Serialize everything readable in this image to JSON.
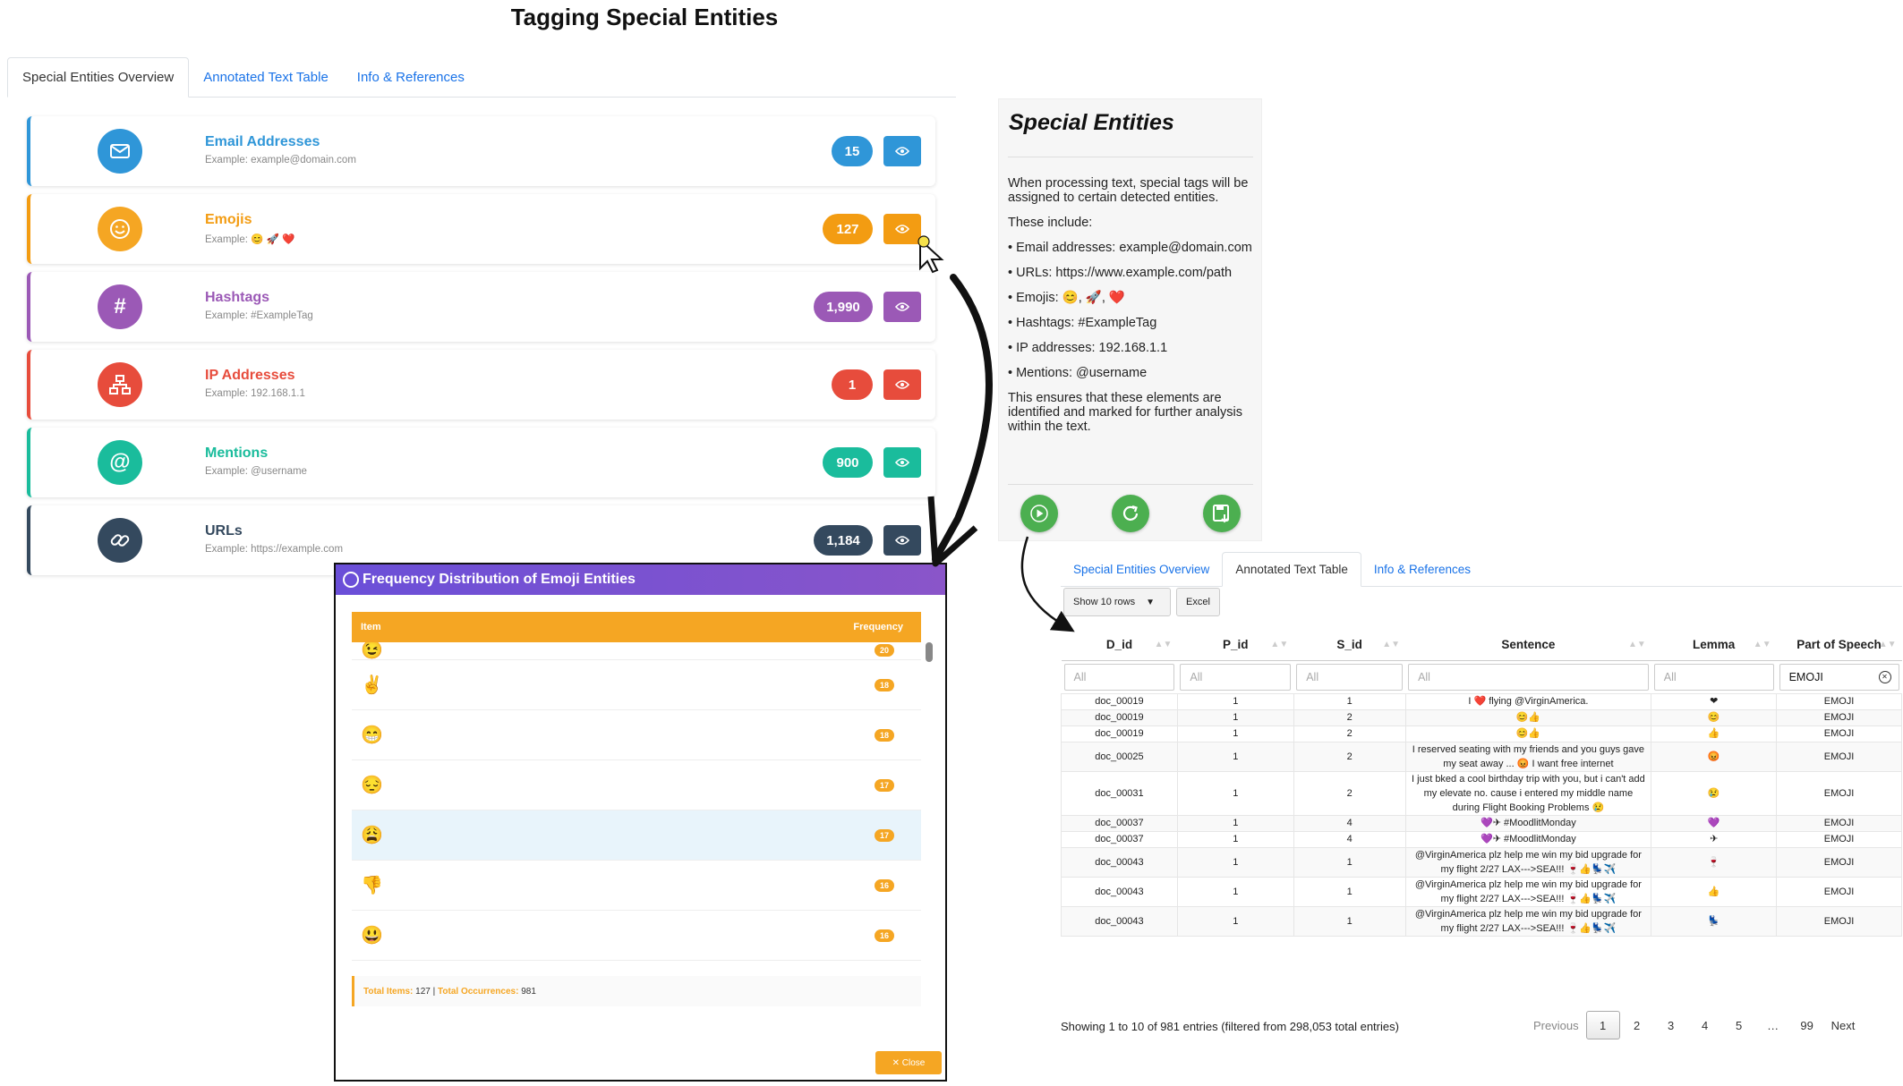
{
  "page_title": "Tagging Special Entities",
  "tabs_left": [
    "Special Entities Overview",
    "Annotated Text Table",
    "Info & References"
  ],
  "tabs_right": [
    "Special Entities Overview",
    "Annotated Text Table",
    "Info & References"
  ],
  "entities": [
    {
      "title": "Email Addresses",
      "example": "Example: example@domain.com",
      "count": "15",
      "color": "#2f96d8",
      "icon": "envelope-icon"
    },
    {
      "title": "Emojis",
      "example": "Example: 😊 🚀 ❤️",
      "count": "127",
      "color": "#f39c12",
      "icon": "smile-icon"
    },
    {
      "title": "Hashtags",
      "example": "Example: #ExampleTag",
      "count": "1,990",
      "color": "#9b59b6",
      "icon": "hashtag-icon"
    },
    {
      "title": "IP Addresses",
      "example": "Example: 192.168.1.1",
      "count": "1",
      "color": "#e74c3c",
      "icon": "network-icon"
    },
    {
      "title": "Mentions",
      "example": "Example: @username",
      "count": "900",
      "color": "#1abc9c",
      "icon": "at-icon"
    },
    {
      "title": "URLs",
      "example": "Example: https://example.com",
      "count": "1,184",
      "color": "#34495e",
      "icon": "link-icon"
    }
  ],
  "info": {
    "title": "Special Entities",
    "paragraphs": [
      "When processing text, special tags will be assigned to certain detected entities.",
      "These include:",
      "• Email addresses: example@domain.com",
      "• URLs: https://www.example.com/path",
      "• Emojis: 😊, 🚀, ❤️",
      "• Hashtags: #ExampleTag",
      "• IP addresses: 192.168.1.1",
      "• Mentions: @username",
      "This ensures that these elements are identified and marked for further analysis within the text."
    ]
  },
  "modal": {
    "title": "Frequency Distribution of Emoji Entities",
    "col_item": "Item",
    "col_freq": "Frequency",
    "rows": [
      {
        "item": "😉",
        "freq": "20"
      },
      {
        "item": "✌️",
        "freq": "18"
      },
      {
        "item": "😁",
        "freq": "18"
      },
      {
        "item": "😔",
        "freq": "17"
      },
      {
        "item": "😩",
        "freq": "17"
      },
      {
        "item": "👎",
        "freq": "16"
      },
      {
        "item": "😃",
        "freq": "16"
      }
    ],
    "total_items_label": "Total Items:",
    "total_items": "127",
    "separator": "|",
    "total_occ_label": "Total Occurrences:",
    "total_occ": "981",
    "close_label": "✕ Close"
  },
  "table": {
    "show_rows": "Show 10 rows",
    "excel": "Excel",
    "columns": [
      "D_id",
      "P_id",
      "S_id",
      "Sentence",
      "Lemma",
      "Part of Speech"
    ],
    "filters": [
      "All",
      "All",
      "All",
      "All",
      "All",
      "EMOJI"
    ],
    "rows": [
      {
        "d": "doc_00019",
        "p": "1",
        "s": "1",
        "sentence": "I ❤️ flying @VirginAmerica.",
        "lemma": "❤",
        "pos": "EMOJI"
      },
      {
        "d": "doc_00019",
        "p": "1",
        "s": "2",
        "sentence": "😊👍",
        "lemma": "😊",
        "pos": "EMOJI"
      },
      {
        "d": "doc_00019",
        "p": "1",
        "s": "2",
        "sentence": "😊👍",
        "lemma": "👍",
        "pos": "EMOJI"
      },
      {
        "d": "doc_00025",
        "p": "1",
        "s": "2",
        "sentence": "I reserved seating with my friends and you guys gave my seat away ... 😡 I want free internet",
        "lemma": "😡",
        "pos": "EMOJI"
      },
      {
        "d": "doc_00031",
        "p": "1",
        "s": "2",
        "sentence": "I just bked a cool birthday trip with you, but i can't add my elevate no. cause i entered my middle name during Flight Booking Problems 😢",
        "lemma": "😢",
        "pos": "EMOJI"
      },
      {
        "d": "doc_00037",
        "p": "1",
        "s": "4",
        "sentence": "💜✈ #MoodlitMonday",
        "lemma": "💜",
        "pos": "EMOJI"
      },
      {
        "d": "doc_00037",
        "p": "1",
        "s": "4",
        "sentence": "💜✈ #MoodlitMonday",
        "lemma": "✈",
        "pos": "EMOJI"
      },
      {
        "d": "doc_00043",
        "p": "1",
        "s": "1",
        "sentence": "@VirginAmerica plz help me win my bid upgrade for my flight 2/27 LAX--->SEA!!! 🍷👍💺✈️",
        "lemma": "🍷",
        "pos": "EMOJI"
      },
      {
        "d": "doc_00043",
        "p": "1",
        "s": "1",
        "sentence": "@VirginAmerica plz help me win my bid upgrade for my flight 2/27 LAX--->SEA!!! 🍷👍💺✈️",
        "lemma": "👍",
        "pos": "EMOJI"
      },
      {
        "d": "doc_00043",
        "p": "1",
        "s": "1",
        "sentence": "@VirginAmerica plz help me win my bid upgrade for my flight 2/27 LAX--->SEA!!! 🍷👍💺✈️",
        "lemma": "💺",
        "pos": "EMOJI"
      }
    ],
    "info": "Showing 1 to 10 of 981 entries (filtered from 298,053 total entries)",
    "pager": [
      "Previous",
      "1",
      "2",
      "3",
      "4",
      "5",
      "…",
      "99",
      "Next"
    ]
  }
}
